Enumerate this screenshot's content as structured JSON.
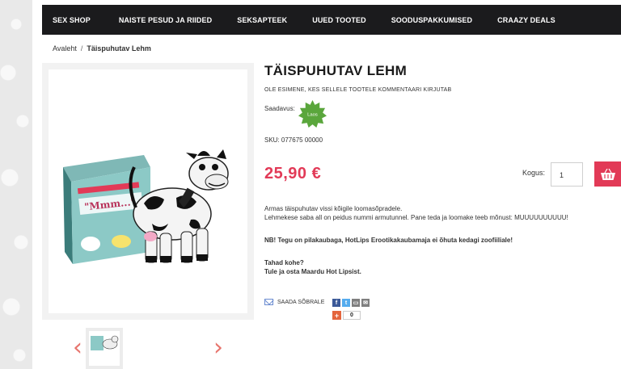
{
  "nav": {
    "items": [
      "SEX SHOP",
      "NAISTE PESUD JA RIIDED",
      "SEKSAPTEEK",
      "UUED TOOTED",
      "SOODUSPAKKUMISED",
      "CRAAZY DEALS"
    ]
  },
  "breadcrumb": {
    "home": "Avaleht",
    "separator": "/",
    "current": "Täispuhutav Lehm"
  },
  "product": {
    "title": "TÄISPUHUTAV LEHM",
    "review_link": "OLE ESIMENE, KES SELLELE TOOTELE KOMMENTAARI KIRJUTAB",
    "availability_label": "Saadavus:",
    "availability_badge": "Laos",
    "sku": "SKU: 077675 00000",
    "price": "25,90 €",
    "quantity_label": "Kogus:",
    "quantity_value": "1",
    "desc_line1": "Armas täispuhutav vissi kõigile loomasõpradele.",
    "desc_line2": "Lehmekese saba all on peidus nummi armutunnel. Pane teda ja loomake teeb mõnust: MUUUUUUUUUU!",
    "notice": "NB! Tegu on pilakaubaga, HotLips Erootikakaubamaja ei õhuta kedagi zoofiiliale!",
    "cta_line1": "Tahad kohe?",
    "cta_line2": "Tule ja osta Maardu Hot Lipsist."
  },
  "share": {
    "label": "SAADA SÕBRALE",
    "counter": "0"
  },
  "icons": {
    "mail": "mail-icon",
    "facebook": "facebook-icon",
    "twitter": "twitter-icon",
    "print": "print-icon",
    "email": "email-icon",
    "cart": "basket-icon",
    "prev": "chevron-left-icon",
    "next": "chevron-right-icon"
  },
  "colors": {
    "accent": "#e23a57",
    "nav_bg": "#1b1b1d",
    "badge": "#5aa63c",
    "facebook": "#3b5998",
    "twitter": "#55acee",
    "print": "#7f7f7f"
  }
}
